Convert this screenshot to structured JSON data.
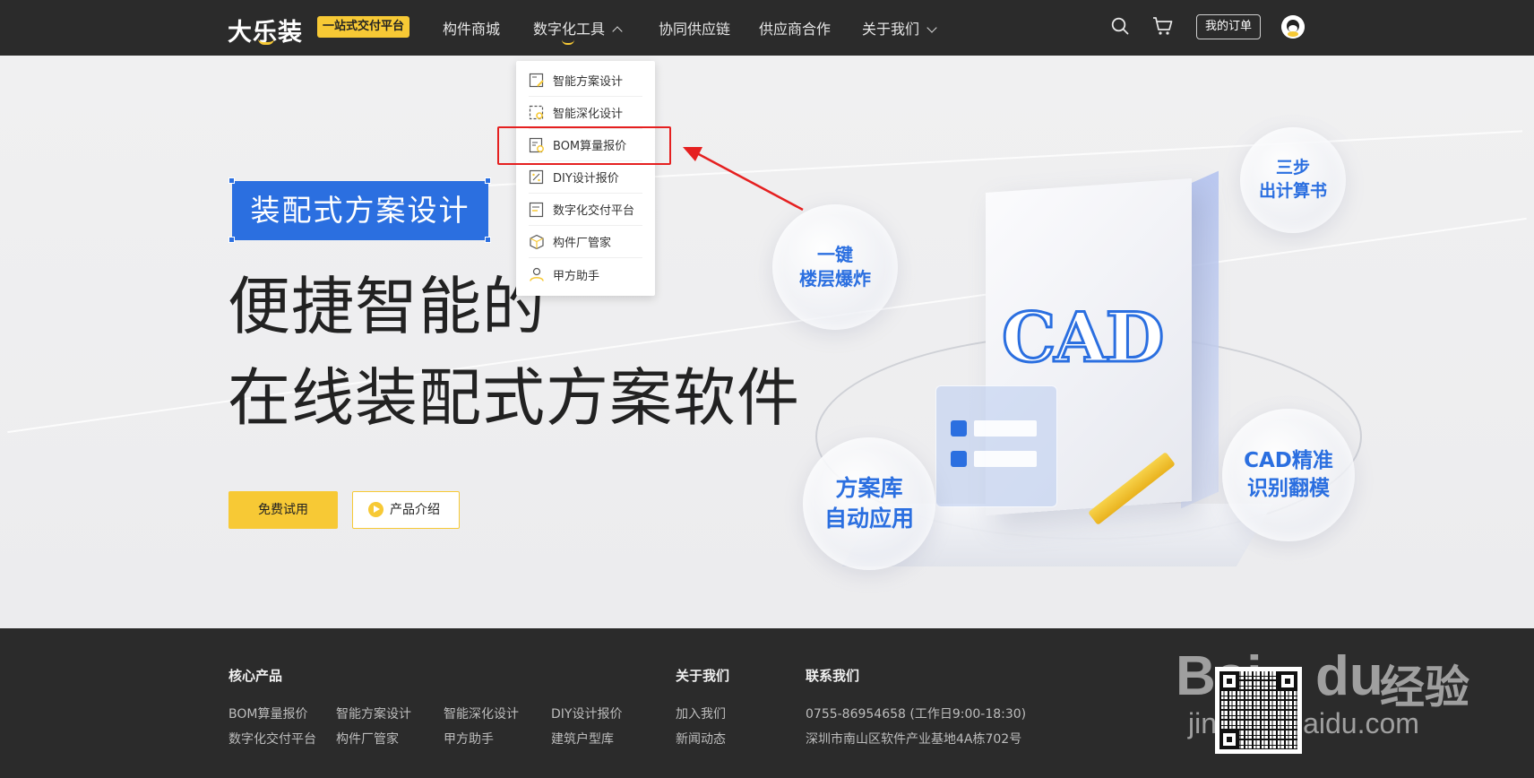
{
  "header": {
    "logo_text": "大乐装",
    "logo_badge": "一站式交付平台",
    "nav": [
      {
        "label": "构件商城"
      },
      {
        "label": "数字化工具"
      },
      {
        "label": "协同供应链"
      },
      {
        "label": "供应商合作"
      },
      {
        "label": "关于我们"
      }
    ],
    "order_button": "我的订单",
    "icons": [
      "search-icon",
      "cart-icon",
      "avatar"
    ]
  },
  "dropdown": {
    "items": [
      {
        "label": "智能方案设计",
        "icon": "plan-design-icon"
      },
      {
        "label": "智能深化设计",
        "icon": "deep-design-icon"
      },
      {
        "label": "BOM算量报价",
        "icon": "bom-quote-icon"
      },
      {
        "label": "DIY设计报价",
        "icon": "diy-quote-icon"
      },
      {
        "label": "数字化交付平台",
        "icon": "delivery-platform-icon"
      },
      {
        "label": "构件厂管家",
        "icon": "factory-manager-icon"
      },
      {
        "label": "甲方助手",
        "icon": "client-assistant-icon"
      }
    ],
    "highlighted_index": 2
  },
  "hero": {
    "tag": "装配式方案设计",
    "headline_1": "便捷智能的",
    "headline_2": "在线装配式方案软件",
    "btn_try": "免费试用",
    "btn_intro": "产品介绍",
    "bubbles": [
      {
        "l1": "三步",
        "l2": "出计算书"
      },
      {
        "l1": "一键",
        "l2": "楼层爆炸"
      },
      {
        "l1": "方案库",
        "l2": "自动应用"
      },
      {
        "l1": "CAD精准",
        "l2": "识别翻模"
      }
    ],
    "cad_label": "CAD"
  },
  "footer": {
    "core_products": {
      "title": "核心产品",
      "row1": [
        "BOM算量报价",
        "智能方案设计",
        "智能深化设计",
        "DIY设计报价"
      ],
      "row2": [
        "数字化交付平台",
        "构件厂管家",
        "甲方助手",
        "建筑户型库"
      ]
    },
    "about": {
      "title": "关于我们",
      "links": [
        "加入我们",
        "新闻动态"
      ]
    },
    "contact": {
      "title": "联系我们",
      "phone": "0755-86954658 (工作日9:00-18:30)",
      "address": "深圳市南山区软件产业基地4A栋702号"
    }
  },
  "watermark": {
    "brand": "Bai",
    "brand2": "du",
    "cn": "经验",
    "url": "jingyan.baidu.com"
  },
  "colors": {
    "accent": "#f7c935",
    "blue": "#2b6fe0",
    "highlight": "#e52020",
    "header_bg": "#2b2b2b"
  }
}
